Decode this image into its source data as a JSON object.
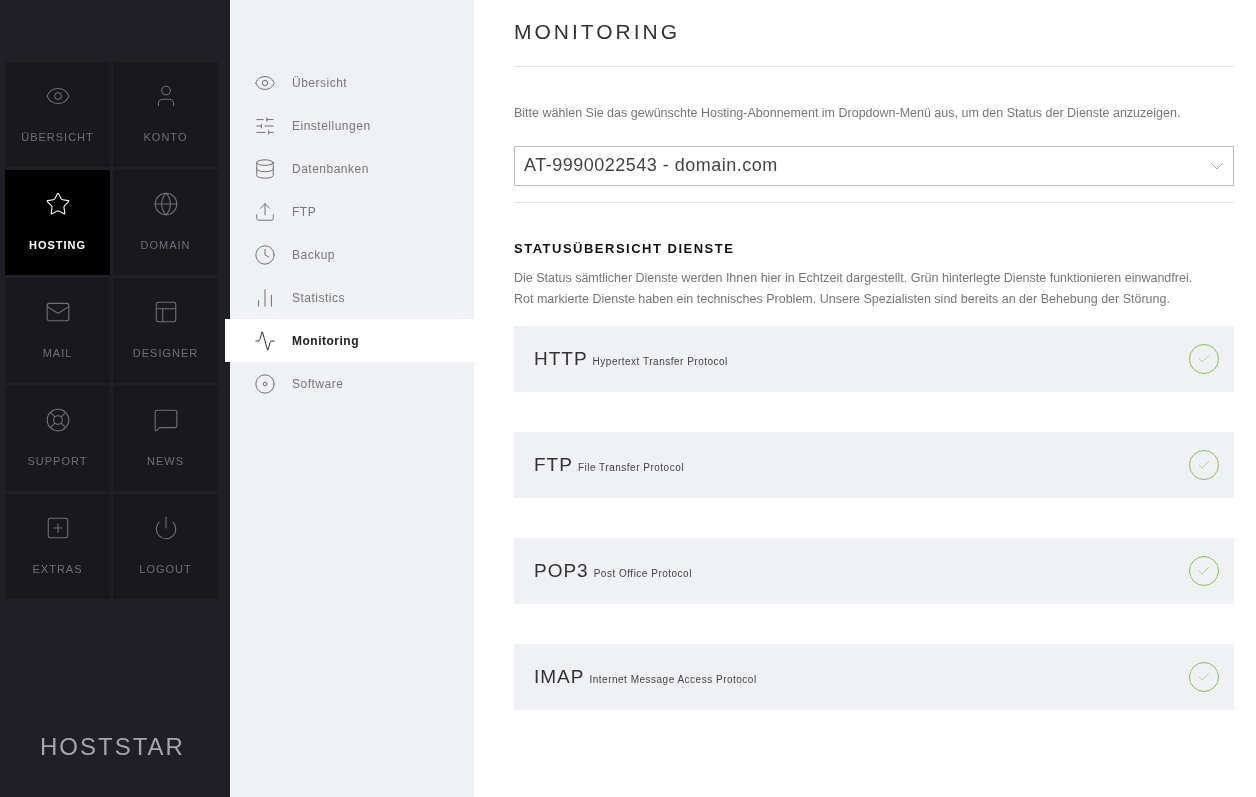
{
  "main_menu": [
    {
      "label": "ÜBERSICHT",
      "selected": false
    },
    {
      "label": "KONTO",
      "selected": false
    },
    {
      "label": "HOSTING",
      "selected": true
    },
    {
      "label": "DOMAIN",
      "selected": false
    },
    {
      "label": "MAIL",
      "selected": false
    },
    {
      "label": "DESIGNER",
      "selected": false
    },
    {
      "label": "SUPPORT",
      "selected": false
    },
    {
      "label": "NEWS",
      "selected": false
    },
    {
      "label": "EXTRAS",
      "selected": false
    },
    {
      "label": "LOGOUT",
      "selected": false
    }
  ],
  "logo": "HOSTSTAR",
  "sub_menu": [
    {
      "label": "Übersicht",
      "selected": false
    },
    {
      "label": "Einstellungen",
      "selected": false
    },
    {
      "label": "Datenbanken",
      "selected": false
    },
    {
      "label": "FTP",
      "selected": false
    },
    {
      "label": "Backup",
      "selected": false
    },
    {
      "label": "Statistics",
      "selected": false
    },
    {
      "label": "Monitoring",
      "selected": true
    },
    {
      "label": "Software",
      "selected": false
    }
  ],
  "page_title": "MONITORING",
  "intro": "Bitte wählen Sie das gewünschte Hosting-Abonnement im Dropdown-Menü aus, um den Status der Dienste anzuzeigen.",
  "subscription_select": {
    "value": "AT-9990022543 - domain.com"
  },
  "section_title": "STATUSÜBERSICHT DIENSTE",
  "section_text": "Die Status sämtlicher Dienste werden Ihnen hier in Echtzeit dargestellt. Grün hinterlegte Dienste funktionieren einwandfrei. Rot markierte Dienste haben ein technisches Problem. Unsere Spezialisten sind bereits an der Behebung der Störung.",
  "services": [
    {
      "name": "HTTP",
      "description": "Hypertext Transfer Protocol",
      "ok": true
    },
    {
      "name": "FTP",
      "description": "File Transfer Protocol",
      "ok": true
    },
    {
      "name": "POP3",
      "description": "Post Office Protocol",
      "ok": true
    },
    {
      "name": "IMAP",
      "description": "Internet Message Access Protocol",
      "ok": true
    }
  ]
}
